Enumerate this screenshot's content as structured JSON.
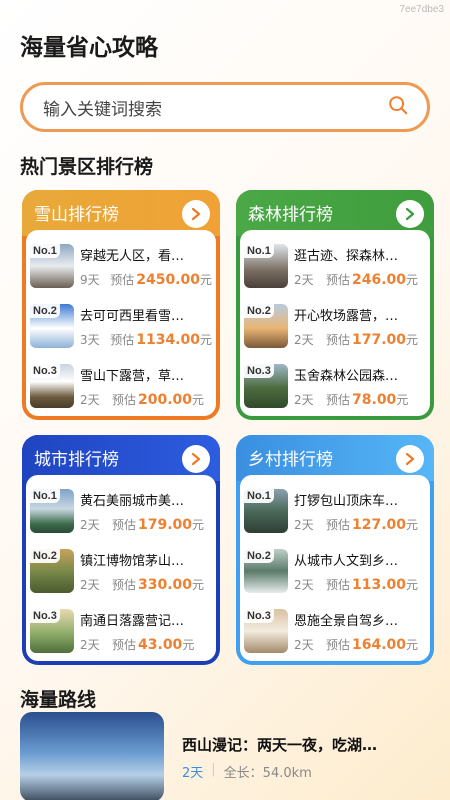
{
  "watermark": "7ee7dbe3",
  "app_title": "海量省心攻略",
  "search": {
    "placeholder": "输入关键词搜索"
  },
  "hot_section_title": "热门景区排行榜",
  "boards": [
    {
      "title": "雪山排行榜",
      "items": [
        {
          "rank": "No.1",
          "name": "穿越无人区，看…",
          "days": "9天",
          "est": "预估",
          "price": "2450.00",
          "unit": "元"
        },
        {
          "rank": "No.2",
          "name": "去可可西里看雪…",
          "days": "3天",
          "est": "预估",
          "price": "1134.00",
          "unit": "元"
        },
        {
          "rank": "No.3",
          "name": "雪山下露营，草…",
          "days": "2天",
          "est": "预估",
          "price": "200.00",
          "unit": "元"
        }
      ]
    },
    {
      "title": "森林排行榜",
      "items": [
        {
          "rank": "No.1",
          "name": "逛古迹、探森林…",
          "days": "2天",
          "est": "预估",
          "price": "246.00",
          "unit": "元"
        },
        {
          "rank": "No.2",
          "name": "开心牧场露营，…",
          "days": "2天",
          "est": "预估",
          "price": "177.00",
          "unit": "元"
        },
        {
          "rank": "No.3",
          "name": "玉舍森林公园森…",
          "days": "2天",
          "est": "预估",
          "price": "78.00",
          "unit": "元"
        }
      ]
    },
    {
      "title": "城市排行榜",
      "items": [
        {
          "rank": "No.1",
          "name": "黄石美丽城市美…",
          "days": "2天",
          "est": "预估",
          "price": "179.00",
          "unit": "元"
        },
        {
          "rank": "No.2",
          "name": "镇江博物馆茅山…",
          "days": "2天",
          "est": "预估",
          "price": "330.00",
          "unit": "元"
        },
        {
          "rank": "No.3",
          "name": "南通日落露营记…",
          "days": "2天",
          "est": "预估",
          "price": "43.00",
          "unit": "元"
        }
      ]
    },
    {
      "title": "乡村排行榜",
      "items": [
        {
          "rank": "No.1",
          "name": "打锣包山顶床车…",
          "days": "2天",
          "est": "预估",
          "price": "127.00",
          "unit": "元"
        },
        {
          "rank": "No.2",
          "name": "从城市人文到乡…",
          "days": "2天",
          "est": "预估",
          "price": "113.00",
          "unit": "元"
        },
        {
          "rank": "No.3",
          "name": "恩施全景自驾乡…",
          "days": "2天",
          "est": "预估",
          "price": "164.00",
          "unit": "元"
        }
      ]
    }
  ],
  "routes_section_title": "海量路线",
  "route": {
    "name": "西山漫记：两天一夜，吃湖…",
    "days": "2天",
    "separator": "|",
    "length": "全长：54.0km"
  },
  "colors": {
    "accent_orange": "#ee8030",
    "snow": "#ee7a23",
    "forest": "#3a9a3e",
    "city": "#1c3fb8",
    "rural": "#3f9ff0"
  }
}
